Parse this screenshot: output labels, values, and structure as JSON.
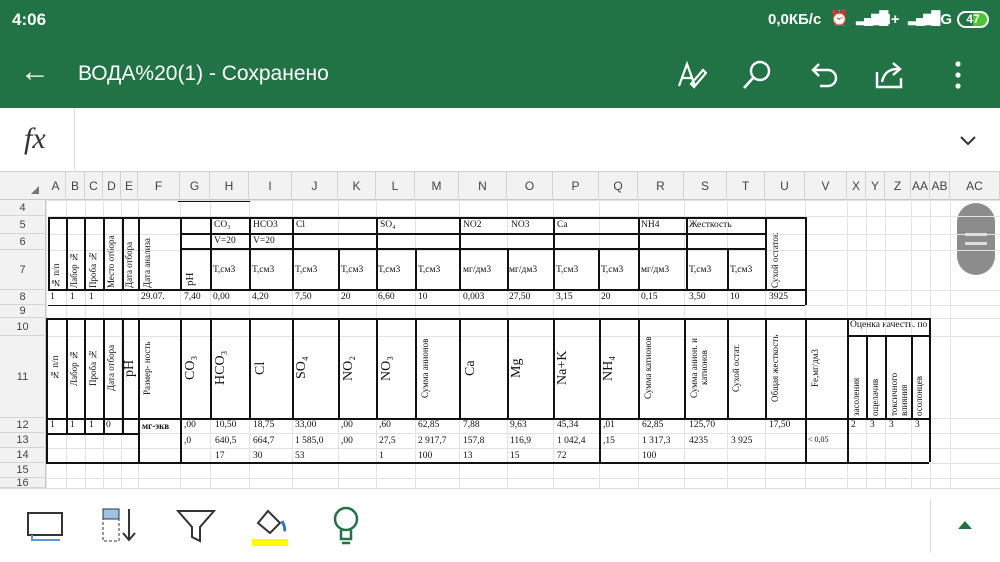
{
  "status": {
    "time": "4:06",
    "speed": "0,0КБ/с",
    "net1": "H+",
    "net2": "3G",
    "battery": "47"
  },
  "appbar": {
    "title": "ВОДА%20(1) - Сохранено"
  },
  "formula": {
    "fx": "fx",
    "value": ""
  },
  "columns": [
    "A",
    "B",
    "C",
    "D",
    "E",
    "F",
    "G",
    "H",
    "I",
    "J",
    "K",
    "L",
    "M",
    "N",
    "O",
    "P",
    "Q",
    "R",
    "S",
    "T",
    "U",
    "V",
    "X",
    "Y",
    "Z",
    "AA",
    "AB",
    "AC"
  ],
  "rows": [
    "4",
    "5",
    "6",
    "7",
    "8",
    "9",
    "10",
    "11",
    "12",
    "13",
    "14",
    "15",
    "16"
  ],
  "table1": {
    "left_headers": [
      "№ п/п",
      "Лабор №",
      "Проба №",
      "Место отбора",
      "Дата отбора",
      "Дата анализа"
    ],
    "ph": "pH",
    "groups": {
      "co3": "CO₃",
      "hco3": "HCO3",
      "cl": "Cl",
      "so4": "SO₄",
      "no2": "NO2",
      "no3": "NO3",
      "ca": "Ca",
      "nh4": "NH4",
      "hard": "Жесткость"
    },
    "v1": "V=20",
    "v2": "V=20",
    "units": [
      "Т,см3",
      "Т,см3",
      "Т,см3",
      "Т,см3",
      "Т,см3",
      "Т,см3",
      "мг/дм3",
      "мг/дм3",
      "Т,см3",
      "Т,см3",
      "мг/дм3",
      "Т,см3",
      "Т,см3"
    ],
    "dry": "Сухой остаток",
    "row": [
      "1",
      "1",
      "1",
      "29.07.",
      "7,40",
      "0,00",
      "4,20",
      "7,50",
      "20",
      "6,60",
      "10",
      "0,003",
      "27,50",
      "3,15",
      "20",
      "0,15",
      "3,50",
      "10",
      "3925"
    ]
  },
  "table2": {
    "headers": [
      "№ п/п",
      "Лабор №",
      "Проба №",
      "Дата отбора",
      "pH",
      "Размер- ность",
      "CO₃",
      "HCO₃",
      "Cl",
      "SO₄",
      "NO₂",
      "NO₃",
      "Сумма анионов",
      "Ca",
      "Mg",
      "Na+K",
      "NH₄",
      "Сумма катионов",
      "Сумма анион. и катионов",
      "Сухой остат.",
      "Общая жесткость",
      "Fe,мг/дм3"
    ],
    "assess_title": "Оценка качеств. по",
    "assess": [
      "засоления",
      "ощелачив",
      "токсичного влияния",
      "осолонцев"
    ],
    "unit": "мг-экв",
    "r12": [
      "1",
      "1",
      "1",
      "0",
      ",00",
      "10,50",
      "18,75",
      "33,00",
      ",00",
      ",60",
      "62,85",
      "7,88",
      "9,63",
      "45,34",
      ",01",
      "62,85",
      "125,70",
      "17,50",
      "2",
      "3",
      "3",
      "3"
    ],
    "r13": [
      ",0",
      "640,5",
      "664,7",
      "1 585,0",
      ",00",
      "27,5",
      "2 917,7",
      "157,8",
      "116,9",
      "1 042,4",
      ",15",
      "1 317,3",
      "4235",
      "3 925",
      "< 0,05"
    ],
    "r14": [
      "17",
      "30",
      "53",
      "1",
      "100",
      "13",
      "15",
      "72",
      "100"
    ]
  },
  "colors": {
    "brand": "#217346",
    "fill_color": "#ffff00",
    "idea": "#217346"
  }
}
